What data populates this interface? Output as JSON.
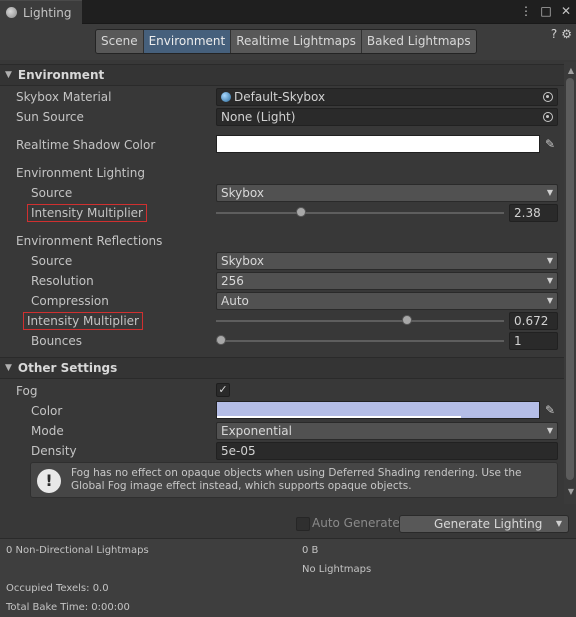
{
  "window": {
    "tab_title": "Lighting",
    "window_icons": [
      "⋮",
      "□",
      "✕"
    ]
  },
  "toolbar": {
    "tabs": [
      "Scene",
      "Environment",
      "Realtime Lightmaps",
      "Baked Lightmaps"
    ],
    "active_tab": "Environment",
    "help_icon": "?",
    "settings_icon": "⚙"
  },
  "environment": {
    "header": "Environment",
    "skybox_material_label": "Skybox Material",
    "skybox_material_value": "Default-Skybox",
    "sun_source_label": "Sun Source",
    "sun_source_value": "None (Light)",
    "shadow_color_label": "Realtime Shadow Color",
    "shadow_color_value": "#ffffff",
    "env_lighting_label": "Environment Lighting",
    "lighting_source_label": "Source",
    "lighting_source_value": "Skybox",
    "lighting_intensity_label": "Intensity Multiplier",
    "lighting_intensity_value": "2.38",
    "lighting_intensity_fraction": 0.2875,
    "env_reflections_label": "Environment Reflections",
    "reflection_source_label": "Source",
    "reflection_source_value": "Skybox",
    "resolution_label": "Resolution",
    "resolution_value": "256",
    "compression_label": "Compression",
    "compression_value": "Auto",
    "reflection_intensity_label": "Intensity Multiplier",
    "reflection_intensity_value": "0.672",
    "reflection_intensity_fraction": 0.67,
    "bounces_label": "Bounces",
    "bounces_value": "1",
    "bounces_fraction": 0.0
  },
  "other_settings": {
    "header": "Other Settings",
    "fog_label": "Fog",
    "fog_checked": "✓",
    "color_label": "Color",
    "fog_color": "#b4bde6",
    "mode_label": "Mode",
    "mode_value": "Exponential",
    "density_label": "Density",
    "density_value": "5e-05",
    "help_text": "Fog has no effect on opaque objects when using Deferred Shading rendering. Use the Global Fog image effect instead, which supports opaque objects."
  },
  "generate": {
    "auto_label": "Auto Generate",
    "button_label": "Generate Lighting"
  },
  "stats": {
    "non_directional": "0 Non-Directional Lightmaps",
    "size": "0 B",
    "no_lightmaps": "No Lightmaps",
    "occupied_texels": "Occupied Texels: 0.0",
    "total_bake_time": "Total Bake Time: 0:00:00"
  },
  "colors": {
    "active_tab": "#46607c",
    "highlight_border": "#d03030"
  }
}
